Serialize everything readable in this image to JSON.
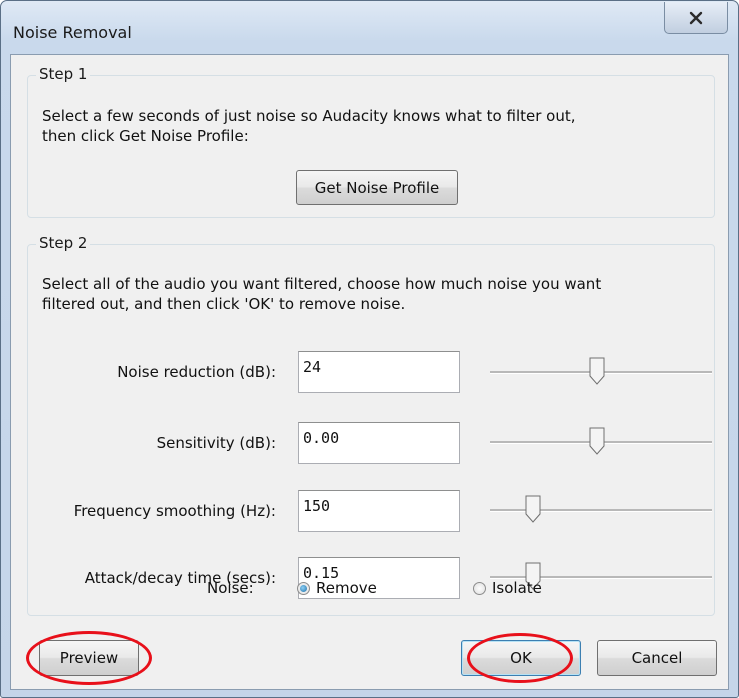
{
  "window": {
    "title": "Noise Removal",
    "close_glyph": "X"
  },
  "step1": {
    "legend": "Step 1",
    "line1": "Select a few seconds of just noise so Audacity knows what to filter out,",
    "line2": "then click Get Noise Profile:",
    "button": "Get Noise Profile"
  },
  "step2": {
    "legend": "Step 2",
    "line1": "Select all of the audio you want filtered, choose how much noise you want",
    "line2": "filtered out, and then click 'OK' to remove noise.",
    "fields": [
      {
        "label": "Noise reduction (dB):",
        "value": "24",
        "slider_fraction": 0.48
      },
      {
        "label": "Sensitivity (dB):",
        "value": "0.00",
        "slider_fraction": 0.48
      },
      {
        "label": "Frequency smoothing (Hz):",
        "value": "150",
        "slider_fraction": 0.17
      },
      {
        "label": "Attack/decay time (secs):",
        "value": "0.15",
        "slider_fraction": 0.17
      }
    ],
    "noise": {
      "label": "Noise:",
      "options": [
        {
          "label": "Remove",
          "checked": true
        },
        {
          "label": "Isolate",
          "checked": false
        }
      ]
    }
  },
  "buttons": {
    "preview": "Preview",
    "ok": "OK",
    "cancel": "Cancel"
  },
  "colors": {
    "annotation": "#e8101a",
    "accent": "#3c7fb1"
  }
}
